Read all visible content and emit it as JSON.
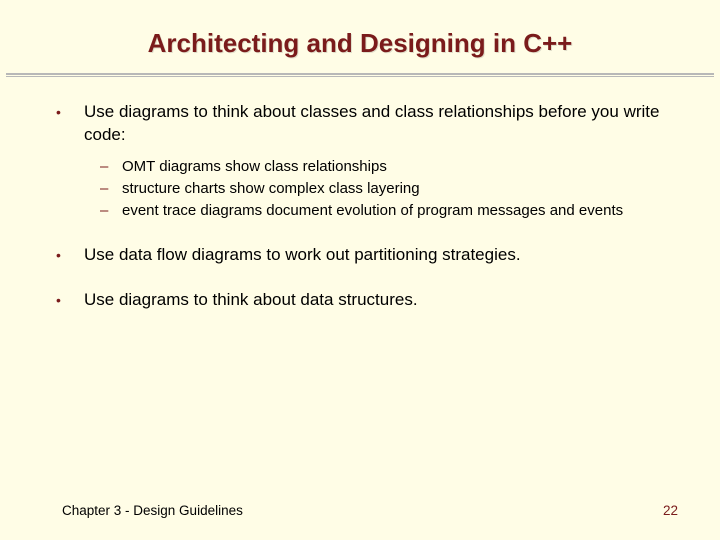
{
  "title": "Architecting and Designing in C++",
  "bullets": {
    "b0": {
      "text": "Use diagrams to think about classes and class relationships before you write code:",
      "subs": {
        "s0": "OMT diagrams show class relationships",
        "s1": "structure charts show complex class layering",
        "s2": "event trace diagrams document evolution of program messages and events"
      }
    },
    "b1": {
      "text": "Use data flow diagrams to work out partitioning strategies."
    },
    "b2": {
      "text": "Use diagrams to think about data structures."
    }
  },
  "footer": {
    "chapter": "Chapter 3 - Design Guidelines",
    "page": "22"
  },
  "colors": {
    "background": "#fffde6",
    "accent": "#7a1b1b"
  }
}
